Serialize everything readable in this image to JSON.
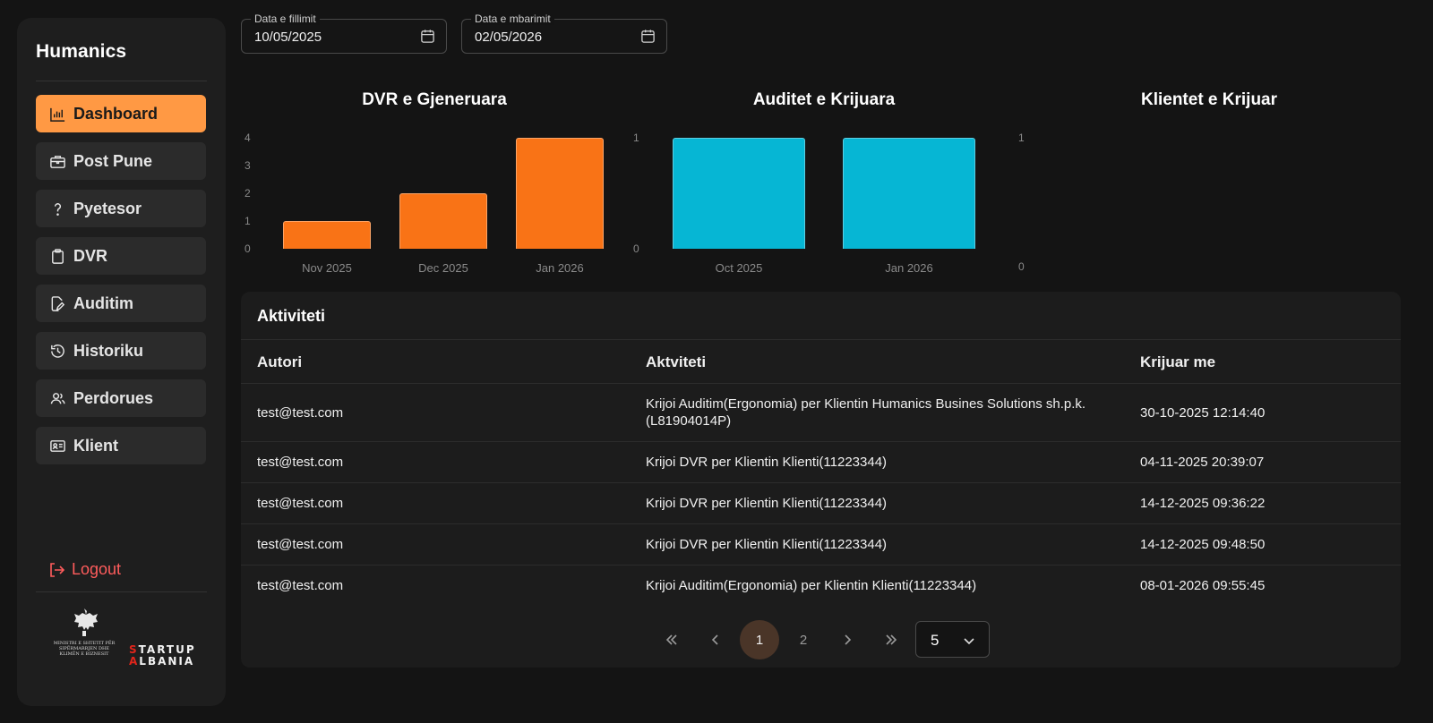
{
  "app": {
    "brand": "Humanics"
  },
  "sidebar": {
    "items": [
      {
        "label": "Dashboard",
        "icon": "bar-chart-icon",
        "active": true
      },
      {
        "label": "Post Pune",
        "icon": "briefcase-icon",
        "active": false
      },
      {
        "label": "Pyetesor",
        "icon": "question-icon",
        "active": false
      },
      {
        "label": "DVR",
        "icon": "clipboard-icon",
        "active": false
      },
      {
        "label": "Auditim",
        "icon": "edit-document-icon",
        "active": false
      },
      {
        "label": "Historiku",
        "icon": "history-icon",
        "active": false
      },
      {
        "label": "Perdorues",
        "icon": "users-icon",
        "active": false
      },
      {
        "label": "Klient",
        "icon": "id-card-icon",
        "active": false
      }
    ],
    "logout_label": "Logout",
    "logos": {
      "ministry_text": "MINISTRI E SHTETIT PËR SIPËRMARRJEN DHE KLIMËN E BIZNESIT",
      "startup_line1": "STARTUP",
      "startup_line2": "ALBANIA"
    }
  },
  "filters": {
    "start": {
      "label": "Data e fillimit",
      "value": "10/05/2025"
    },
    "end": {
      "label": "Data e mbarimit",
      "value": "02/05/2026"
    }
  },
  "colors": {
    "accent": "#ff9944",
    "bar_orange": "#f97316",
    "bar_cyan": "#06b6d4",
    "logout": "#ff5c5c"
  },
  "chart_data": [
    {
      "type": "bar",
      "title": "DVR e Gjeneruara",
      "categories": [
        "Nov 2025",
        "Dec 2025",
        "Jan 2026"
      ],
      "values": [
        1,
        2,
        4
      ],
      "ylim": [
        0,
        4
      ],
      "yticks": [
        "0",
        "1",
        "2",
        "3",
        "4"
      ],
      "color": "#f97316"
    },
    {
      "type": "bar",
      "title": "Auditet e Krijuara",
      "categories": [
        "Oct 2025",
        "Jan 2026"
      ],
      "values": [
        1,
        1
      ],
      "ylim": [
        0,
        1
      ],
      "yticks": [
        "0",
        "1"
      ],
      "color": "#06b6d4"
    },
    {
      "type": "bar",
      "title": "Klientet e Krijuar",
      "categories": [],
      "values": [],
      "ylim": [
        0,
        1
      ],
      "yticks": [
        "0",
        "1"
      ],
      "color": "#06b6d4"
    }
  ],
  "activity": {
    "title": "Aktiviteti",
    "columns": [
      "Autori",
      "Aktviteti",
      "Krijuar me"
    ],
    "rows": [
      {
        "author": "test@test.com",
        "activity": "Krijoi Auditim(Ergonomia) per Klientin Humanics Busines Solutions sh.p.k. (L81904014P)",
        "created": "30-10-2025 12:14:40"
      },
      {
        "author": "test@test.com",
        "activity": "Krijoi DVR per Klientin Klienti(11223344)",
        "created": "04-11-2025 20:39:07"
      },
      {
        "author": "test@test.com",
        "activity": "Krijoi DVR per Klientin Klienti(11223344)",
        "created": "14-12-2025 09:36:22"
      },
      {
        "author": "test@test.com",
        "activity": "Krijoi DVR per Klientin Klienti(11223344)",
        "created": "14-12-2025 09:48:50"
      },
      {
        "author": "test@test.com",
        "activity": "Krijoi Auditim(Ergonomia) per Klientin Klienti(11223344)",
        "created": "08-01-2026 09:55:45"
      }
    ]
  },
  "pagination": {
    "pages": [
      "1",
      "2"
    ],
    "current": "1",
    "page_size": "5"
  }
}
